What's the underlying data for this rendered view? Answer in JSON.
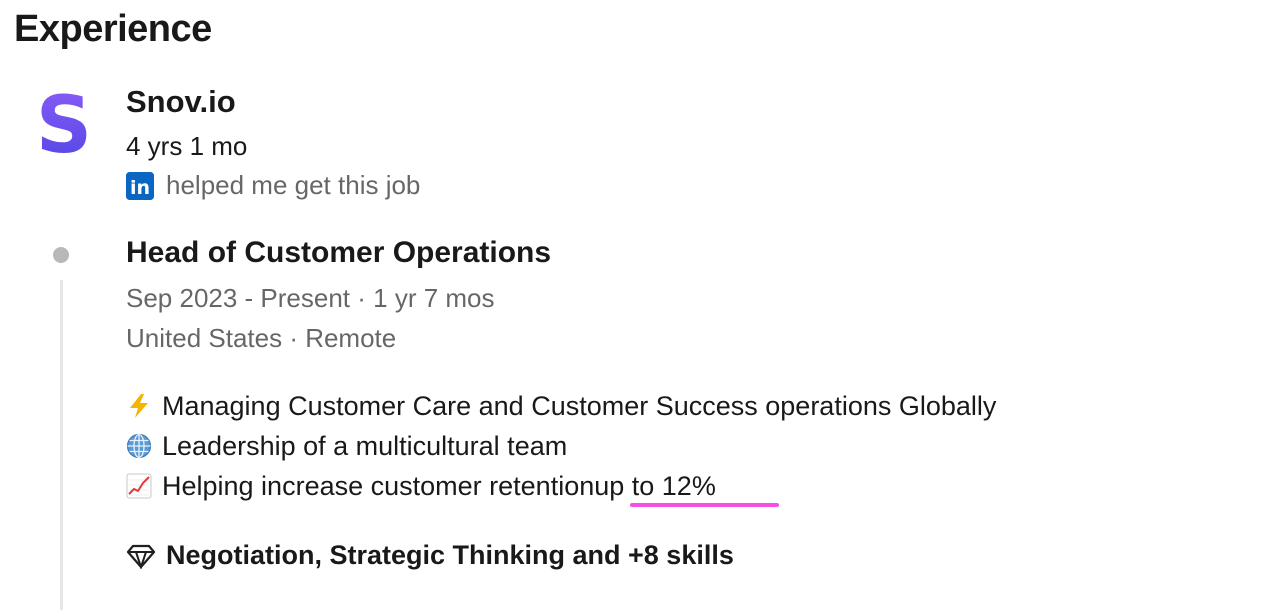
{
  "section": {
    "title": "Experience"
  },
  "company": {
    "name": "Snov.io",
    "logo_letter": "S",
    "duration": "4 yrs 1 mo",
    "helped_text": "helped me get this job",
    "linkedin_icon_text": "in"
  },
  "position": {
    "title": "Head of Customer Operations",
    "dates": "Sep 2023 - Present · 1 yr 7 mos",
    "location": "United States · Remote"
  },
  "description": [
    {
      "icon": "lightning-icon",
      "text": "Managing Customer Care and Customer Success operations Globally"
    },
    {
      "icon": "globe-icon",
      "text": "Leadership of a multicultural team"
    },
    {
      "icon": "chart-increasing-icon",
      "text": "Helping increase customer retention ",
      "highlight": "up to 12%"
    }
  ],
  "skills": {
    "icon": "diamond-icon",
    "text": "Negotiation, Strategic Thinking and +8 skills"
  },
  "colors": {
    "linkedin_blue": "#0a66c2",
    "logo_purple_top": "#8b5cf6",
    "logo_purple_bottom": "#4f46e5",
    "underline_pink": "#f54ee6",
    "timeline_gray": "#b8b8b8"
  }
}
